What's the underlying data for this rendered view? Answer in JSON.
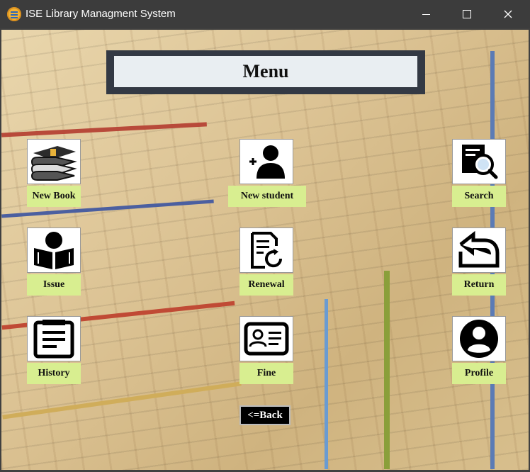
{
  "window": {
    "title": "ISE Library Managment System",
    "icons": [
      "app-icon",
      "minimize-icon",
      "maximize-icon",
      "close-icon"
    ]
  },
  "menu": {
    "title": "Menu"
  },
  "tiles": [
    {
      "label": "New Book",
      "icon": "books-stack-icon"
    },
    {
      "label": "New student",
      "icon": "add-user-icon"
    },
    {
      "label": "Search",
      "icon": "search-document-icon"
    },
    {
      "label": "Issue",
      "icon": "reader-icon"
    },
    {
      "label": "Renewal",
      "icon": "renew-document-icon"
    },
    {
      "label": "Return",
      "icon": "return-arrow-icon"
    },
    {
      "label": "History",
      "icon": "clipboard-list-icon"
    },
    {
      "label": "Fine",
      "icon": "id-card-icon"
    },
    {
      "label": "Profile",
      "icon": "profile-icon"
    }
  ],
  "back": {
    "label": "<=Back"
  },
  "colors": {
    "tile_label_bg": "#d8ee90",
    "menu_frame": "#333944",
    "titlebar": "#3c3c3c"
  }
}
